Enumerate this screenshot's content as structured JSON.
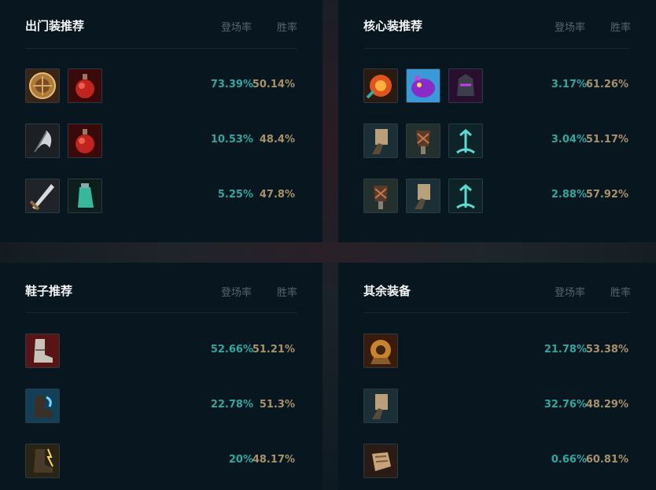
{
  "headers": {
    "rate": "登场率",
    "win": "胜率"
  },
  "panels": [
    {
      "title": "出门装推荐",
      "rows": [
        {
          "items": [
            "doran-shield-icon",
            "health-potion-icon"
          ],
          "rate": "73.39%",
          "win": "50.14%"
        },
        {
          "items": [
            "scythe-blade-icon",
            "health-potion-icon"
          ],
          "rate": "10.53%",
          "win": "48.4%"
        },
        {
          "items": [
            "long-sword-icon",
            "refillable-potion-icon"
          ],
          "rate": "5.25%",
          "win": "47.8%"
        }
      ]
    },
    {
      "title": "核心装推荐",
      "rows": [
        {
          "items": [
            "sunfire-cape-icon",
            "purple-beast-icon",
            "dark-helm-icon"
          ],
          "rate": "3.17%",
          "win": "61.26%"
        },
        {
          "items": [
            "hammer-gauntlet-icon",
            "black-cleaver-icon",
            "teal-trident-icon"
          ],
          "rate": "3.04%",
          "win": "51.17%"
        },
        {
          "items": [
            "black-cleaver-icon",
            "hammer-gauntlet-icon",
            "teal-trident-icon"
          ],
          "rate": "2.88%",
          "win": "57.92%"
        }
      ]
    },
    {
      "title": "鞋子推荐",
      "rows": [
        {
          "items": [
            "plated-boots-icon"
          ],
          "rate": "52.66%",
          "win": "51.21%"
        },
        {
          "items": [
            "mercury-boots-icon"
          ],
          "rate": "22.78%",
          "win": "51.3%"
        },
        {
          "items": [
            "swift-boots-icon"
          ],
          "rate": "20%",
          "win": "48.17%"
        }
      ]
    },
    {
      "title": "其余装备",
      "rows": [
        {
          "items": [
            "gold-armor-icon"
          ],
          "rate": "21.78%",
          "win": "53.38%"
        },
        {
          "items": [
            "hammer-gauntlet-icon"
          ],
          "rate": "32.76%",
          "win": "48.29%"
        },
        {
          "items": [
            "stone-fist-icon"
          ],
          "rate": "0.66%",
          "win": "60.81%"
        }
      ]
    }
  ]
}
